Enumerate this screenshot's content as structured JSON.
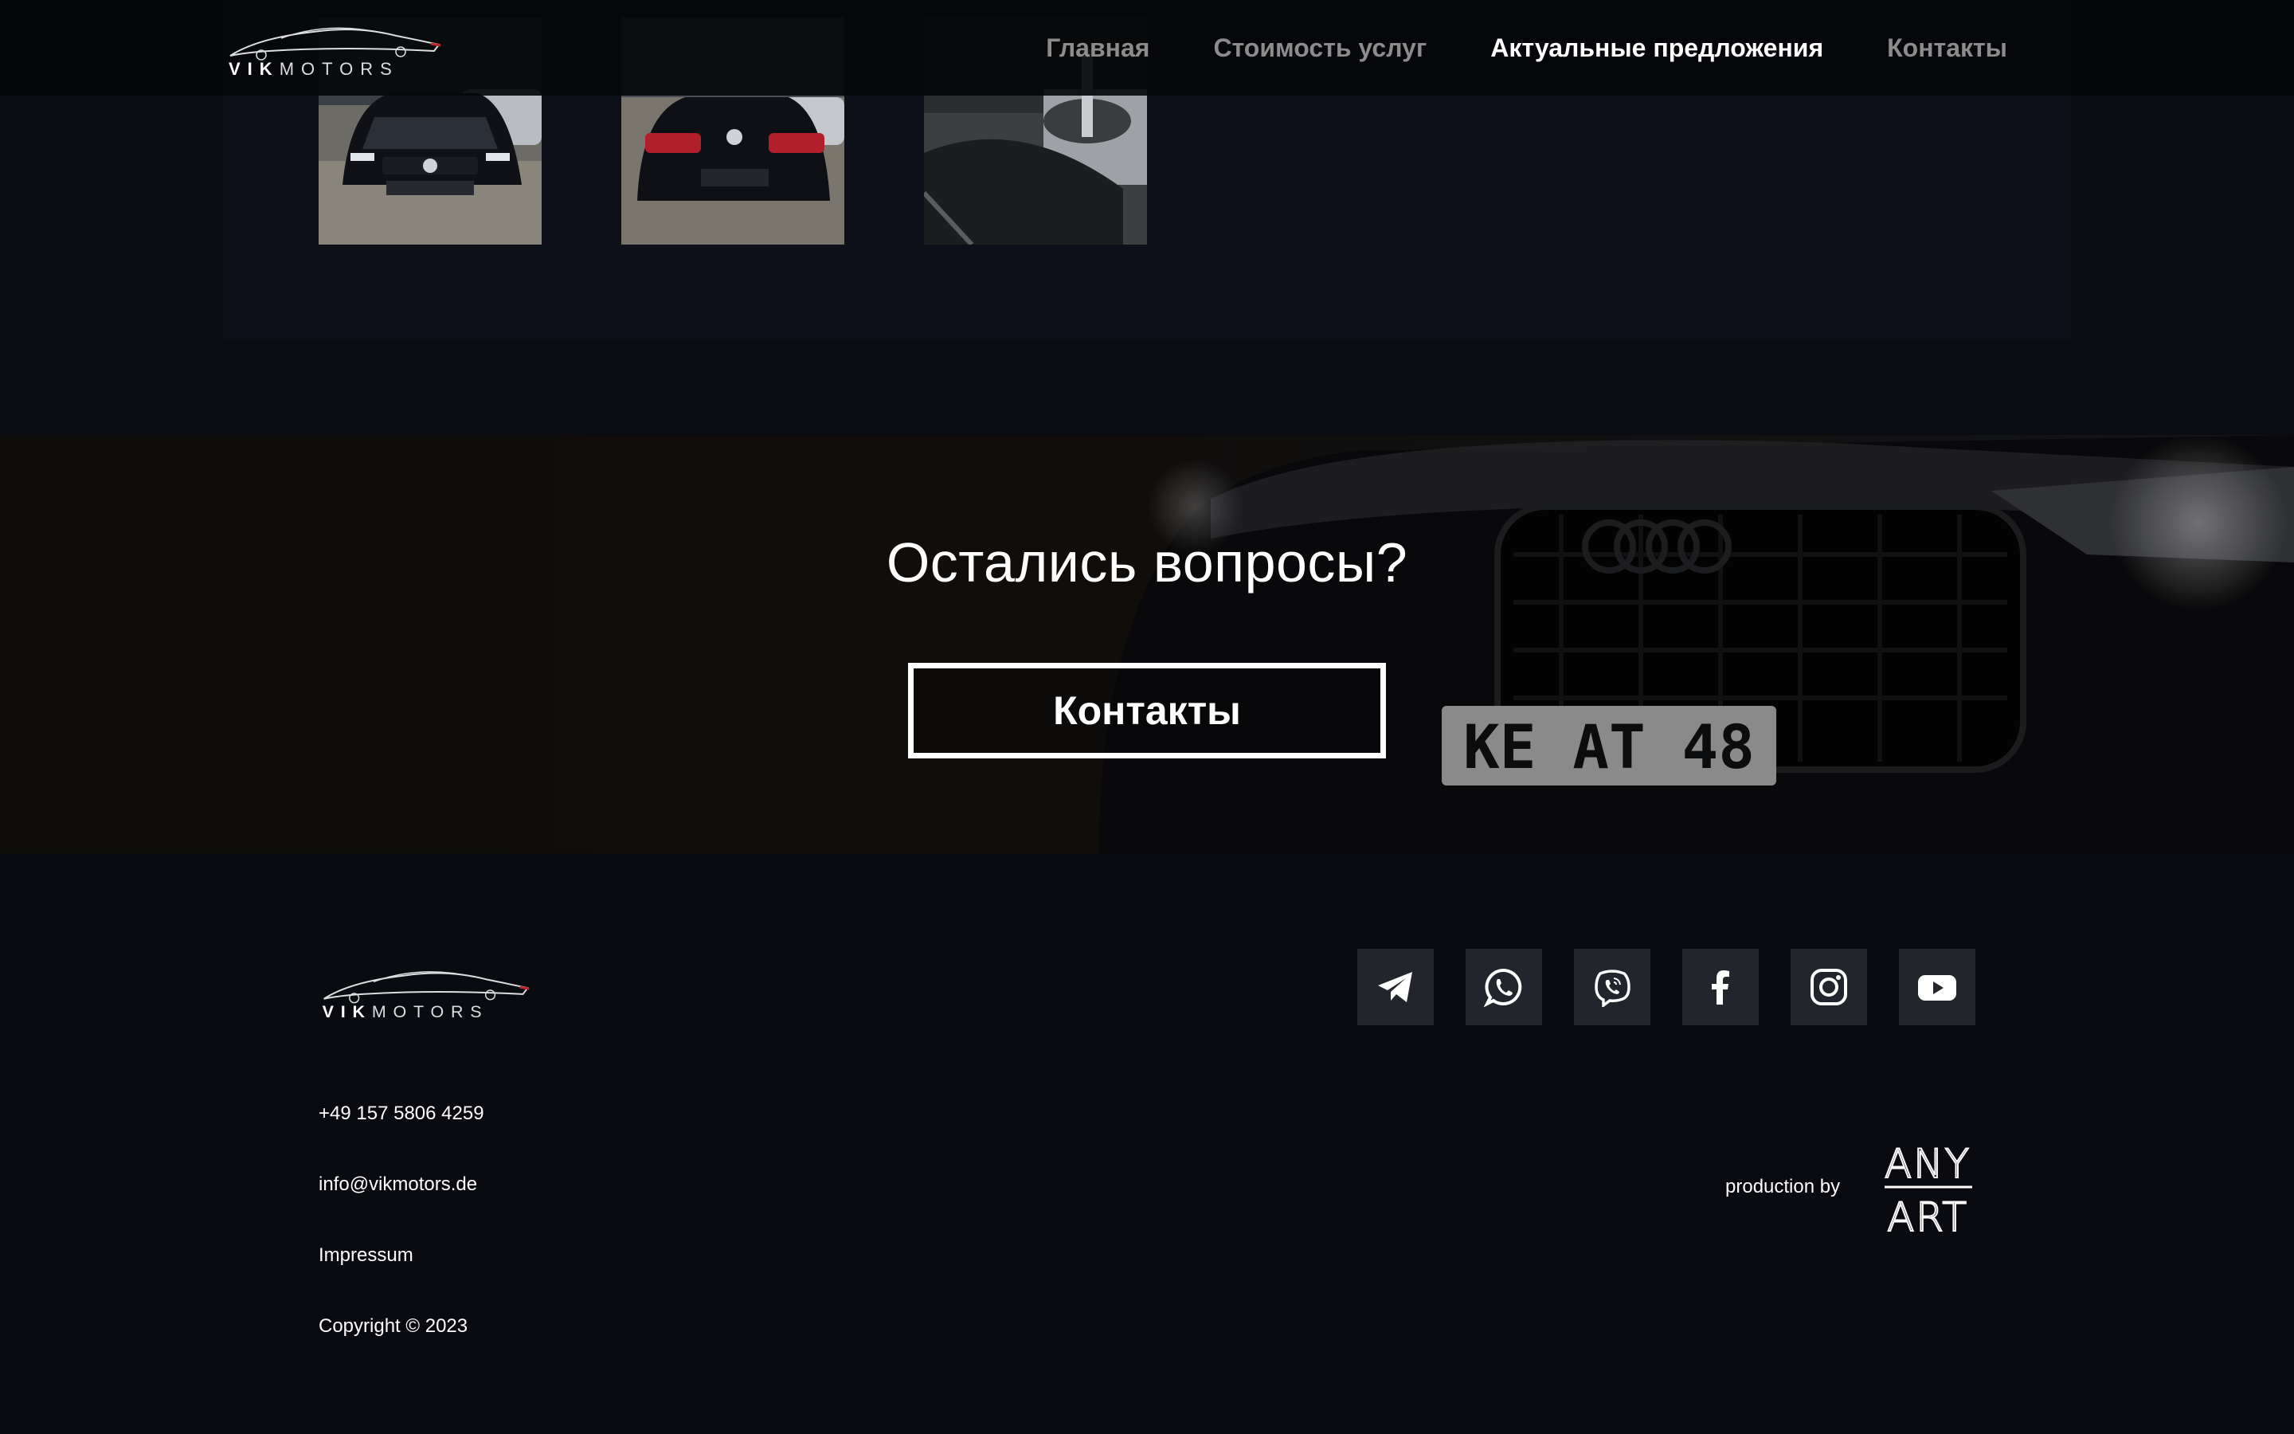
{
  "header": {
    "logo_text_bold": "VIK",
    "logo_text_light": "MOTORS",
    "nav": [
      {
        "label": "Главная"
      },
      {
        "label": "Стоимость услуг"
      },
      {
        "label": "Актуальные предложения"
      },
      {
        "label": "Контакты"
      }
    ],
    "active_nav": "Актуальные предложения"
  },
  "gallery": {
    "thumbnails": [
      {
        "subject": "car front view"
      },
      {
        "subject": "car rear view"
      },
      {
        "subject": "car interior"
      }
    ]
  },
  "cta": {
    "title": "Остались вопросы?",
    "button_label": "Контакты",
    "background_plate": "KE AT 48"
  },
  "footer": {
    "logo_text_bold": "VIK",
    "logo_text_light": "MOTORS",
    "phone": "+49 157 5806 4259",
    "email": "info@vikmotors.de",
    "impressum": "Impressum",
    "copyright": "Copyright © 2023",
    "social": [
      {
        "icon": "telegram-icon"
      },
      {
        "icon": "whatsapp-icon"
      },
      {
        "icon": "viber-icon"
      },
      {
        "icon": "facebook-icon"
      },
      {
        "icon": "instagram-icon"
      },
      {
        "icon": "youtube-icon"
      }
    ],
    "production_label": "production by",
    "production_logo_top": "ANY",
    "production_logo_bottom": "ART"
  },
  "colors": {
    "page_bg": "#0a0c12",
    "card_bg": "#0d1019",
    "nav_inactive": "#8c8c8c",
    "nav_active": "#ffffff",
    "social_bg": "#22252b"
  }
}
